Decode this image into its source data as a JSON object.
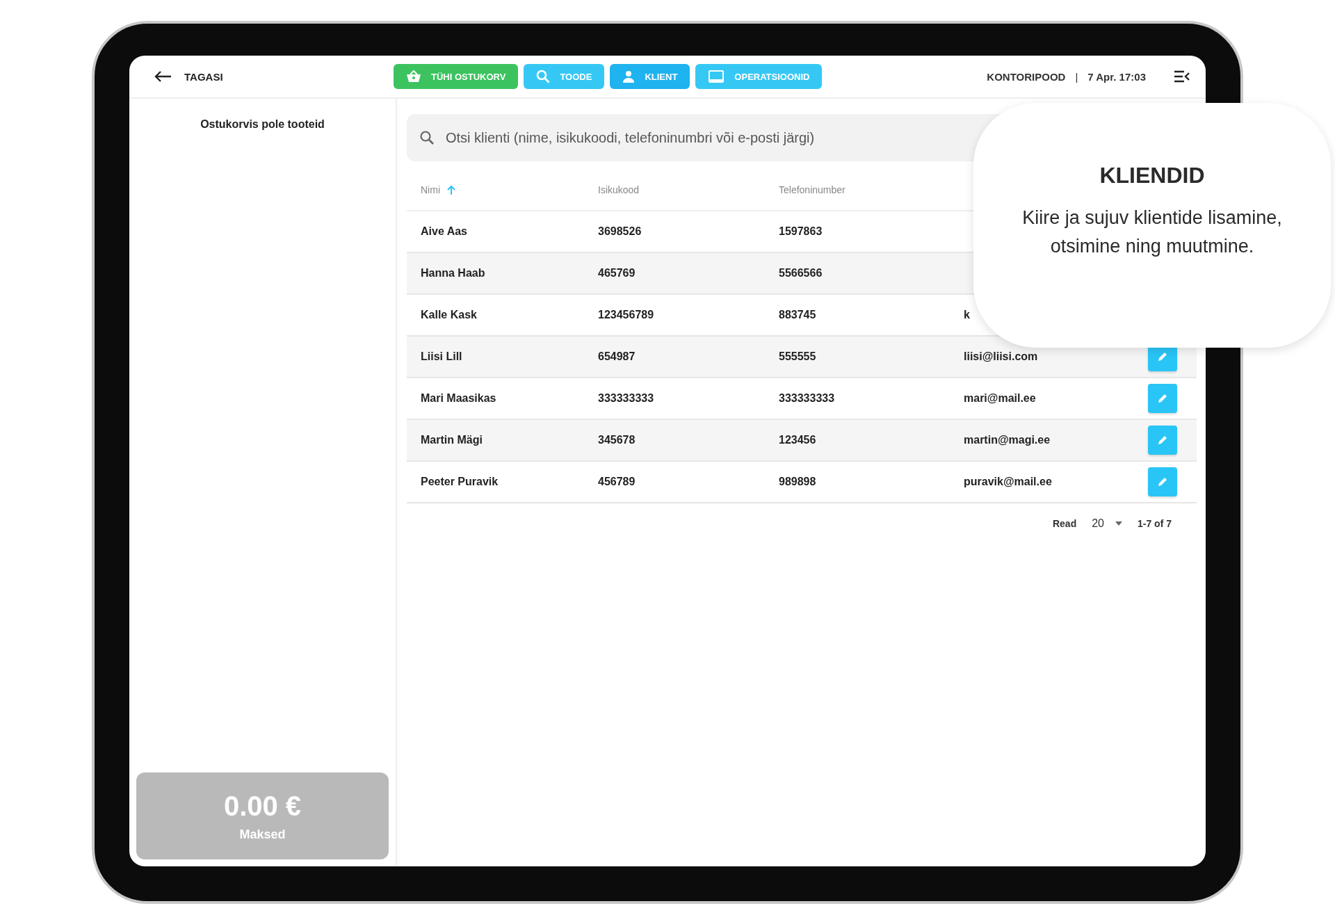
{
  "header": {
    "back": "TAGASI",
    "buttons": [
      {
        "label": "TÜHI OSTUKORV",
        "kind": "basket",
        "color": "#3cc35f"
      },
      {
        "label": "TOODE",
        "kind": "search",
        "color": "#36c8f5"
      },
      {
        "label": "KLIENT",
        "kind": "person",
        "color": "#1fb3ef"
      },
      {
        "label": "OPERATSIOONID",
        "kind": "screen",
        "color": "#36c8f5"
      }
    ],
    "store": "KONTORIPOOD",
    "separator": "|",
    "datetime": "7 Apr. 17:03"
  },
  "sidebar": {
    "empty_text": "Ostukorvis pole tooteid",
    "total": "0.00 €",
    "total_label": "Maksed"
  },
  "search": {
    "placeholder": "Otsi klienti (nime, isikukoodi, telefoninumbri või e-posti järgi)"
  },
  "table": {
    "columns": [
      {
        "label": "Nimi",
        "sorted": true
      },
      {
        "label": "Isikukood",
        "sorted": false
      },
      {
        "label": "Telefoninumber",
        "sorted": false
      }
    ],
    "rows": [
      {
        "name": "Aive Aas",
        "id_code": "3698526",
        "phone": "1597863",
        "edit_button": false
      },
      {
        "name": "Hanna Haab",
        "id_code": "465769",
        "phone": "5566566",
        "edit_button": false
      },
      {
        "name": "Kalle Kask",
        "id_code": "123456789",
        "phone": "883745",
        "email": "k",
        "edit_button": false
      },
      {
        "name": "Liisi Lill",
        "id_code": "654987",
        "phone": "555555",
        "email": "liisi@liisi.com",
        "edit_button": true
      },
      {
        "name": "Mari Maasikas",
        "id_code": "333333333",
        "phone": "333333333",
        "email": "mari@mail.ee",
        "edit_button": true
      },
      {
        "name": "Martin Mägi",
        "id_code": "345678",
        "phone": "123456",
        "email": "martin@magi.ee",
        "edit_button": true
      },
      {
        "name": "Peeter Puravik",
        "id_code": "456789",
        "phone": "989898",
        "email": "puravik@mail.ee",
        "edit_button": true
      }
    ]
  },
  "pagination": {
    "label": "Read",
    "per_page": "20",
    "range": "1-7 of 7"
  },
  "callout": {
    "title": "KLIENDID",
    "text": "Kiire ja sujuv klientide lisamine, otsimine ning muutmine."
  }
}
